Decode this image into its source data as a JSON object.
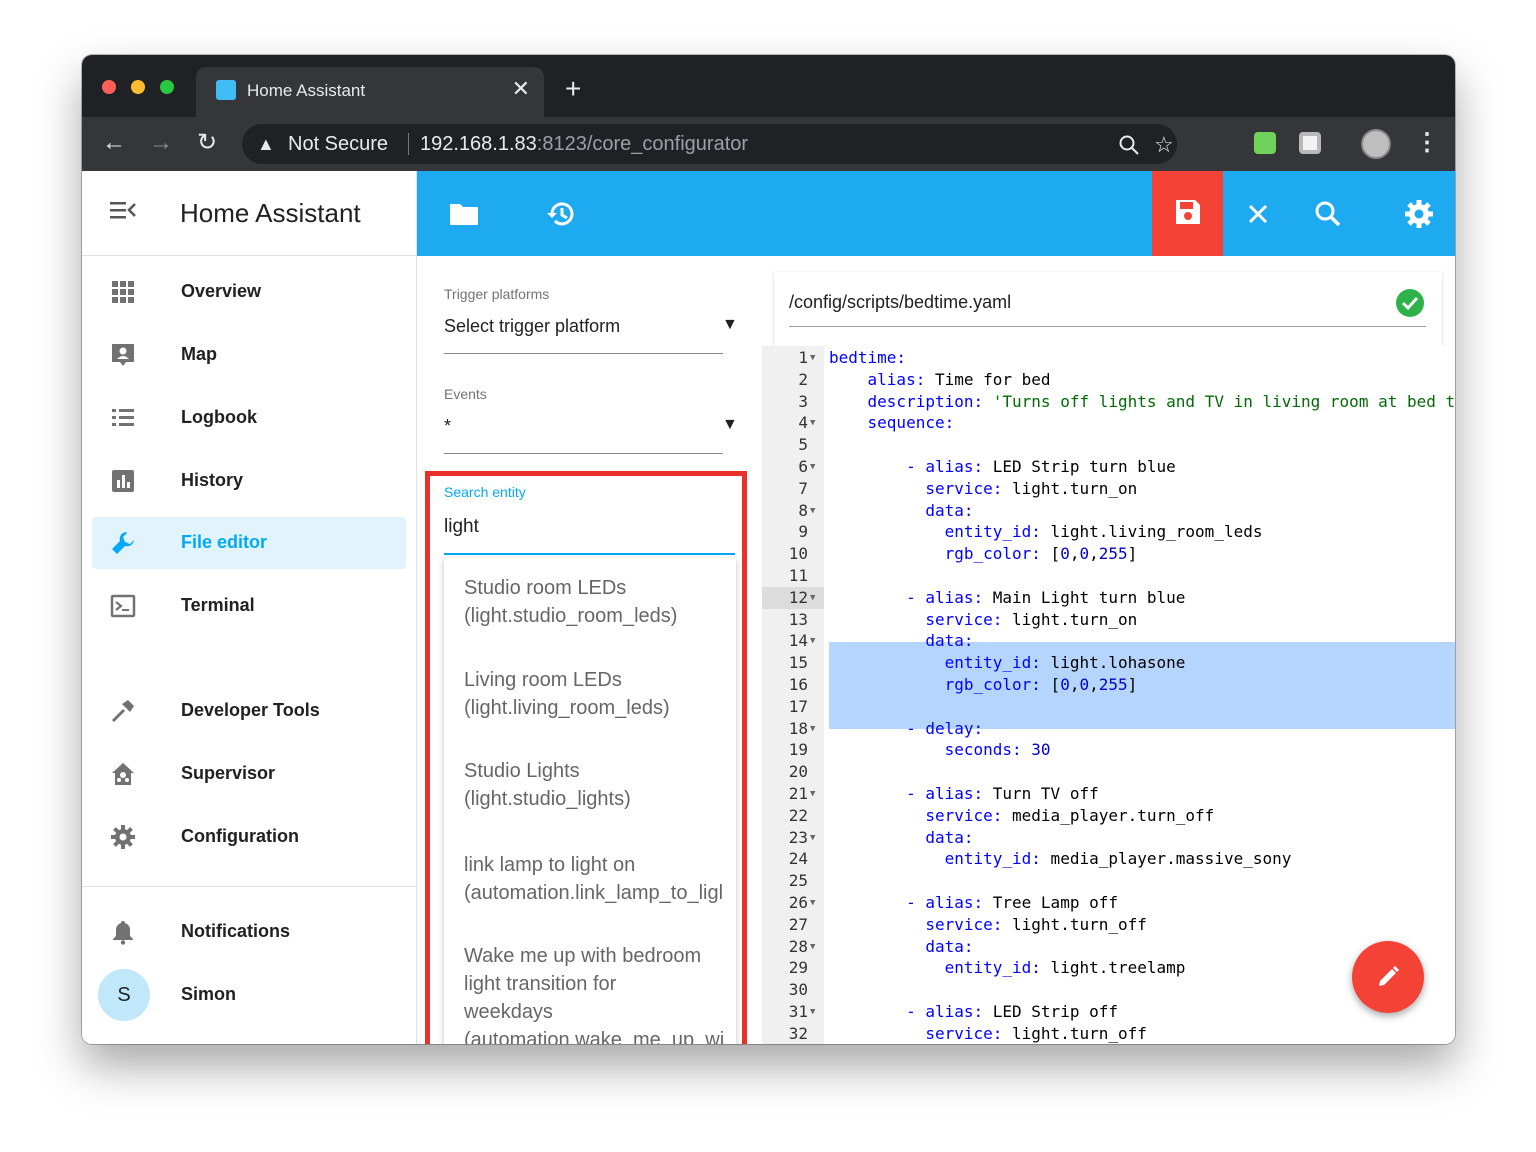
{
  "browser": {
    "tab_title": "Home Assistant",
    "tab_close": "✕",
    "new_tab": "+",
    "security_label": "Not Secure",
    "url_host": "192.168.1.83",
    "url_rest": ":8123/core_configurator"
  },
  "sidebar": {
    "title": "Home Assistant",
    "items": [
      {
        "label": "Overview",
        "icon": "grid-icon"
      },
      {
        "label": "Map",
        "icon": "map-icon"
      },
      {
        "label": "Logbook",
        "icon": "list-icon"
      },
      {
        "label": "History",
        "icon": "chart-icon"
      },
      {
        "label": "File editor",
        "icon": "wrench-icon",
        "active": true
      },
      {
        "label": "Terminal",
        "icon": "terminal-icon"
      },
      {
        "label": "Developer Tools",
        "icon": "hammer-icon"
      },
      {
        "label": "Supervisor",
        "icon": "supervisor-icon"
      },
      {
        "label": "Configuration",
        "icon": "gear-icon"
      },
      {
        "label": "Notifications",
        "icon": "bell-icon"
      },
      {
        "label": "Simon",
        "avatar": "S"
      }
    ]
  },
  "left_panel": {
    "trigger_label": "Trigger platforms",
    "trigger_value": "Select trigger platform",
    "events_label": "Events",
    "events_value": "*",
    "search_label": "Search entity",
    "search_value": "light",
    "results": [
      {
        "line1": "Studio room LEDs",
        "line2": "(light.studio_room_leds)"
      },
      {
        "line1": "Living room LEDs",
        "line2": "(light.living_room_leds)"
      },
      {
        "line1": "Studio Lights",
        "line2": "(light.studio_lights)"
      },
      {
        "line1": "link lamp to light on",
        "line2": "(automation.link_lamp_to_ligl"
      },
      {
        "line1": "Wake me up with bedroom",
        "line2": "light transition for",
        "line3": "weekdays",
        "line4": "(automation.wake_me_up_wi"
      }
    ]
  },
  "editor": {
    "path": "/config/scripts/bedtime.yaml",
    "lines": [
      "bedtime:",
      "    alias: Time for bed",
      "    description: 'Turns off lights and TV in living room at bed ti",
      "    sequence:",
      "",
      "        - alias: LED Strip turn blue",
      "          service: light.turn_on",
      "          data:",
      "            entity_id: light.living_room_leds",
      "            rgb_color: [0,0,255]",
      "",
      "        - alias: Main Light turn blue",
      "          service: light.turn_on",
      "          data:",
      "            entity_id: light.lohasone",
      "            rgb_color: [0,0,255]",
      "",
      "        - delay:",
      "            seconds: 30",
      "",
      "        - alias: Turn TV off",
      "          service: media_player.turn_off",
      "          data:",
      "            entity_id: media_player.massive_sony",
      "",
      "        - alias: Tree Lamp off",
      "          service: light.turn_off",
      "          data:",
      "            entity_id: light.treelamp",
      "",
      "        - alias: LED Strip off",
      "          service: light.turn_off"
    ],
    "folds": [
      1,
      4,
      6,
      8,
      12,
      14,
      18,
      21,
      23,
      26,
      28,
      31
    ],
    "highlight": [
      12,
      13,
      14,
      15,
      16
    ]
  },
  "colors": {
    "accent": "#1eaaf1",
    "save": "#f44336",
    "active_nav": "#03a9f4",
    "ok": "#2db34a",
    "highlight_box": "#e9302a"
  }
}
